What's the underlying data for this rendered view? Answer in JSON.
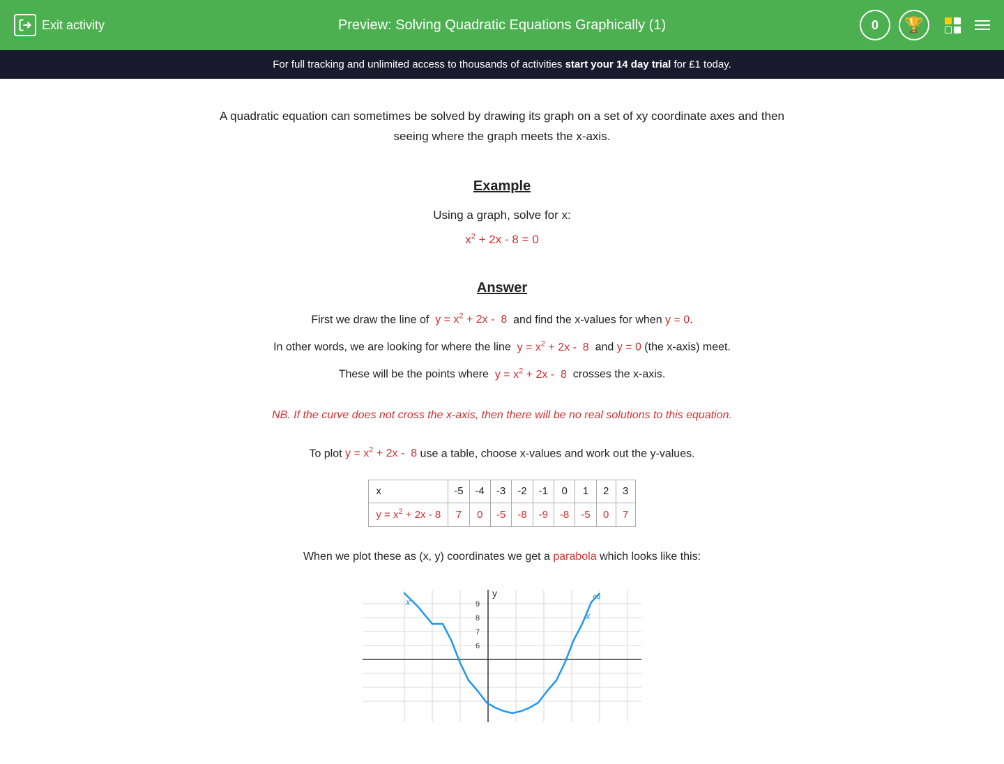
{
  "header": {
    "exit_label": "Exit activity",
    "title": "Preview: Solving Quadratic Equations Graphically (1)",
    "score": "0",
    "bg_color": "#4caf50"
  },
  "banner": {
    "text_before": "For full tracking and unlimited access to thousands of activities ",
    "bold_text": "start your 14 day trial",
    "text_after": " for £1 today."
  },
  "content": {
    "intro": "A quadratic equation can sometimes be solved by drawing its graph on a set of xy coordinate axes and then seeing where the graph meets the x-axis.",
    "example_heading": "Example",
    "example_instruction": "Using a graph, solve for x:",
    "equation_display": "x² + 2x - 8 = 0",
    "answer_heading": "Answer",
    "answer_line1_before": "First we draw the line of  ",
    "answer_line1_eq": "y = x² + 2x -  8",
    "answer_line1_after": " and find the x-values for when ",
    "answer_line1_y0": "y = 0",
    "answer_line1_end": ".",
    "answer_line2_before": "In other words, we are looking for where the line  ",
    "answer_line2_eq1": "y = x² + 2x -  8",
    "answer_line2_mid": "  and ",
    "answer_line2_eq2": "y = 0",
    "answer_line2_after": " (the x-axis) meet.",
    "answer_line3_before": "These will be the points where  ",
    "answer_line3_eq": "y = x² + 2x -  8",
    "answer_line3_after": " crosses the x-axis.",
    "nb_text": "NB.  If the curve does not cross the x-axis, then there will be no real solutions to this equation.",
    "plot_before": "To plot ",
    "plot_eq": "y = x² + 2x -  8",
    "plot_after": " use a table, choose x-values and work out the y-values.",
    "table": {
      "x_label": "x",
      "x_values": [
        "-5",
        "-4",
        "-3",
        "-2",
        "-1",
        "0",
        "1",
        "2",
        "3"
      ],
      "y_label": "y = x² + 2x - 8",
      "y_values": [
        "7",
        "0",
        "-5",
        "-8",
        "-9",
        "-8",
        "-5",
        "0",
        "7"
      ]
    },
    "parabola_before": "When we plot these as (x, y) coordinates we get a ",
    "parabola_word": "parabola",
    "parabola_after": " which looks like this:"
  }
}
